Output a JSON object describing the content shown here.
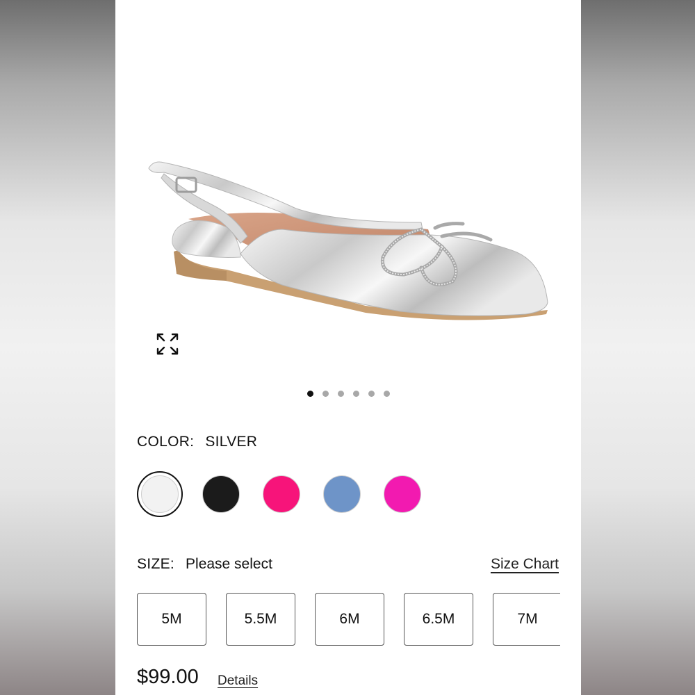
{
  "product": {
    "image_alt": "silver-slingback-flat-with-rhinestone-bow",
    "expand_icon": "expand-icon"
  },
  "carousel": {
    "total": 6,
    "active_index": 0
  },
  "color": {
    "label": "COLOR:",
    "selected": "SILVER",
    "swatches": [
      {
        "name": "silver",
        "color": "#f2f2f2",
        "selected": true
      },
      {
        "name": "black",
        "color": "#1b1b1b",
        "selected": false
      },
      {
        "name": "pink",
        "color": "#f7147a",
        "selected": false
      },
      {
        "name": "denim",
        "color": "#6e94c8",
        "selected": false
      },
      {
        "name": "magenta",
        "color": "#f21ab0",
        "selected": false
      }
    ]
  },
  "size": {
    "label": "SIZE:",
    "value": "Please select",
    "chart_link": "Size Chart",
    "options": [
      "5M",
      "5.5M",
      "6M",
      "6.5M",
      "7M"
    ]
  },
  "price": {
    "amount": "$99.00",
    "details_link": "Details"
  }
}
